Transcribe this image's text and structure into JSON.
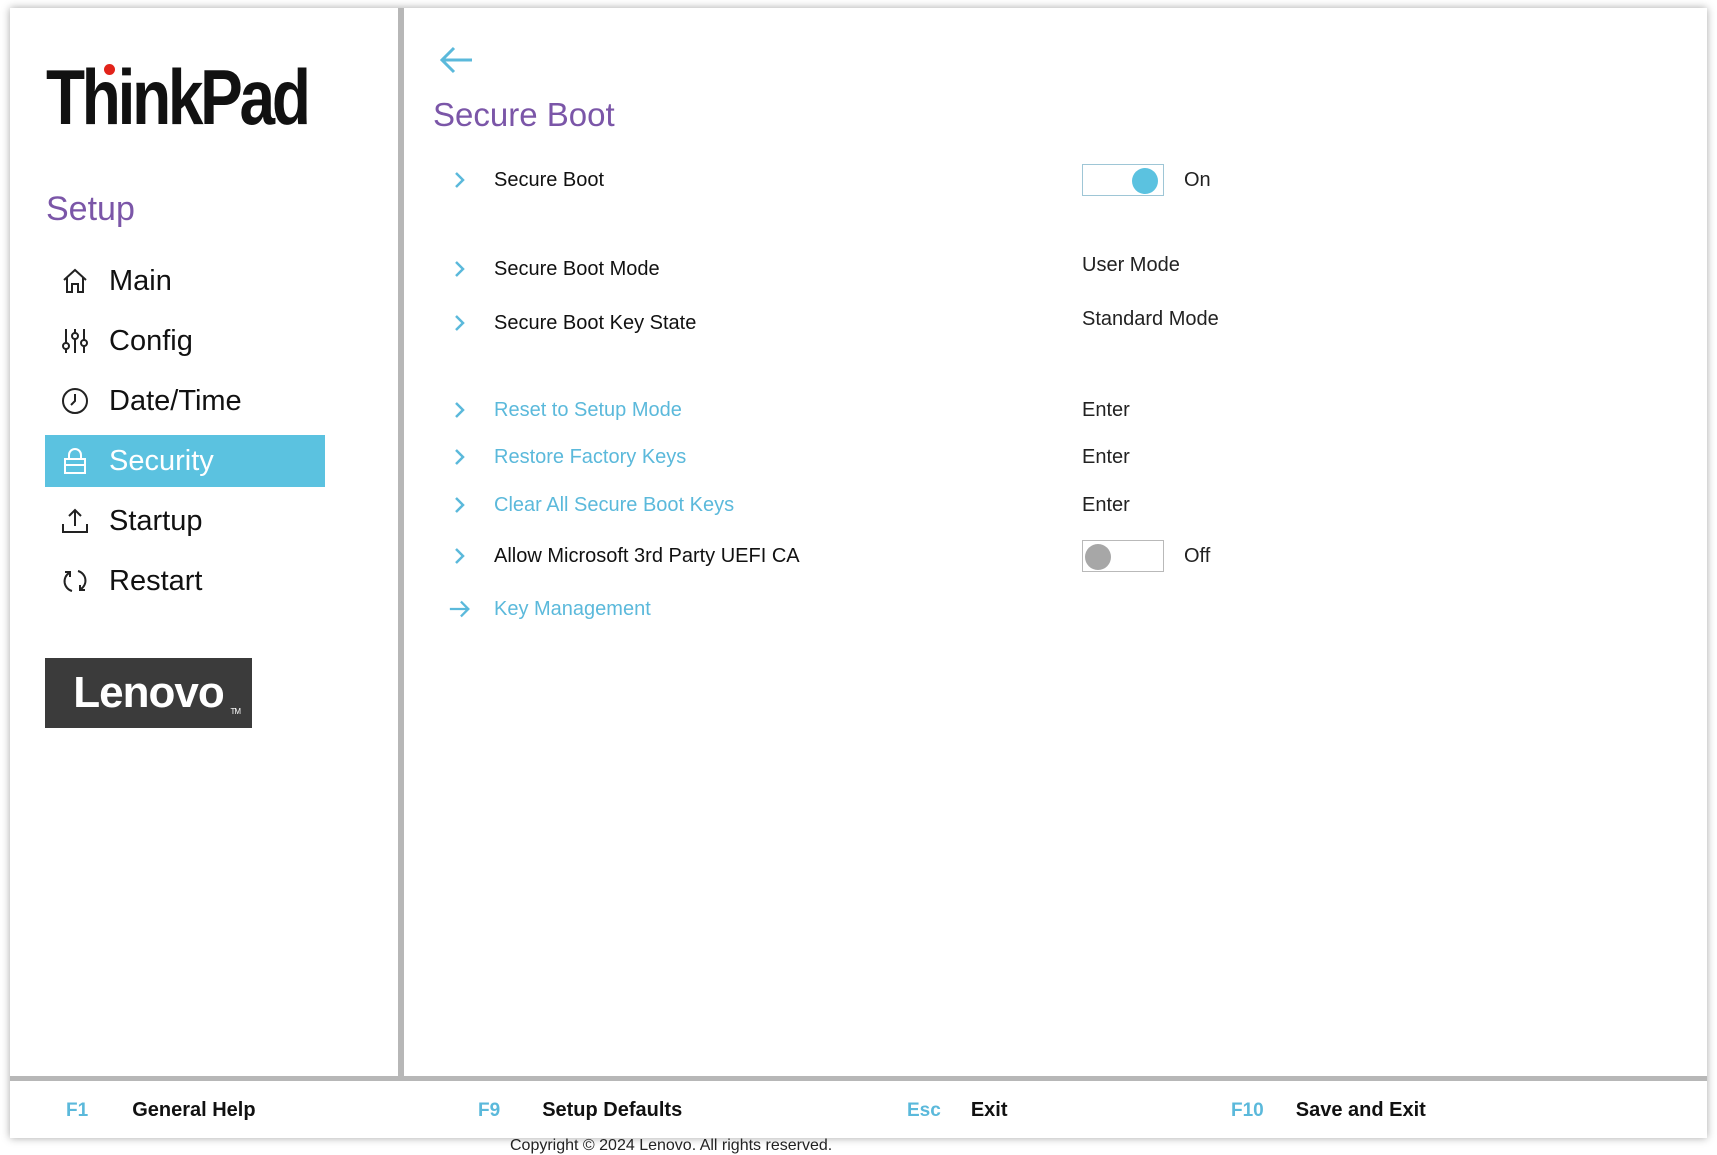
{
  "brand": {
    "name": "ThinkPad",
    "vendor_logo": "Lenovo",
    "vendor_logo_tm": "TM"
  },
  "colors": {
    "accent": "#5bc2e0",
    "heading": "#7b56a8",
    "link": "#5bb9db",
    "logo_dot": "#e2231a"
  },
  "sidebar": {
    "heading": "Setup",
    "items": [
      {
        "label": "Main",
        "icon": "home-icon",
        "active": false
      },
      {
        "label": "Config",
        "icon": "sliders-icon",
        "active": false
      },
      {
        "label": "Date/Time",
        "icon": "clock-icon",
        "active": false
      },
      {
        "label": "Security",
        "icon": "lock-icon",
        "active": true
      },
      {
        "label": "Startup",
        "icon": "upload-icon",
        "active": false
      },
      {
        "label": "Restart",
        "icon": "restart-icon",
        "active": false
      }
    ]
  },
  "page": {
    "title": "Secure Boot",
    "rows": [
      {
        "label": "Secure Boot",
        "type": "toggle",
        "state": "on",
        "value": "On"
      },
      {
        "label": "Secure Boot Mode",
        "type": "text",
        "value": "User Mode"
      },
      {
        "label": "Secure Boot Key State",
        "type": "text",
        "value": "Standard Mode"
      },
      {
        "label": "Reset to Setup Mode",
        "type": "action",
        "value": "Enter"
      },
      {
        "label": "Restore Factory Keys",
        "type": "action",
        "value": "Enter"
      },
      {
        "label": "Clear All Secure Boot Keys",
        "type": "action",
        "value": "Enter"
      },
      {
        "label": "Allow Microsoft 3rd Party UEFI CA",
        "type": "toggle",
        "state": "off",
        "value": "Off"
      },
      {
        "label": "Key Management",
        "type": "link"
      }
    ]
  },
  "footer": {
    "keys": [
      {
        "key": "F1",
        "label": "General Help"
      },
      {
        "key": "F9",
        "label": "Setup Defaults"
      },
      {
        "key": "Esc",
        "label": "Exit"
      },
      {
        "key": "F10",
        "label": "Save and Exit"
      }
    ],
    "copyright": "Copyright © 2024 Lenovo. All rights reserved."
  }
}
